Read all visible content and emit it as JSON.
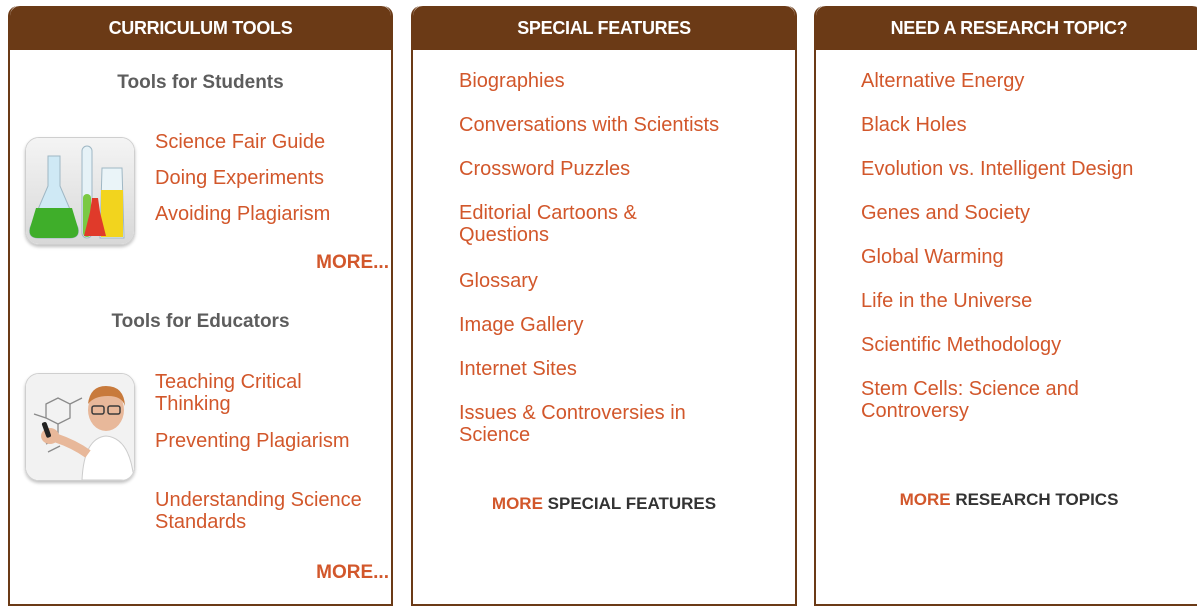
{
  "colors": {
    "header_bg": "#6b3a16",
    "link": "#d2572b",
    "subhead": "#5d5d5d",
    "more_dark": "#333333"
  },
  "curriculum": {
    "header": "CURRICULUM TOOLS",
    "students": {
      "title": "Tools for Students",
      "links": [
        "Science Fair Guide",
        "Doing Experiments",
        "Avoiding Plagiarism"
      ],
      "more": "MORE...",
      "image_icon": "laboratory-flasks-icon"
    },
    "educators": {
      "title": "Tools for Educators",
      "links": [
        "Teaching Critical Thinking",
        "Preventing Plagiarism",
        "Understanding Science Standards"
      ],
      "more": "MORE...",
      "image_icon": "teacher-writing-icon"
    }
  },
  "special": {
    "header": "SPECIAL FEATURES",
    "links": [
      "Biographies",
      "Conversations with Scientists",
      "Crossword Puzzles",
      "Editorial Cartoons & Questions",
      "Glossary",
      "Image Gallery",
      "Internet Sites",
      "Issues & Controversies in Science"
    ],
    "more_word": "MORE",
    "more_rest": "SPECIAL FEATURES"
  },
  "research": {
    "header": "NEED A RESEARCH TOPIC?",
    "links": [
      "Alternative Energy",
      "Black Holes",
      "Evolution vs. Intelligent Design",
      "Genes and Society",
      "Global Warming",
      "Life in the Universe",
      "Scientific Methodology",
      "Stem Cells: Science and Controversy"
    ],
    "more_word": "MORE",
    "more_rest": "RESEARCH TOPICS"
  }
}
